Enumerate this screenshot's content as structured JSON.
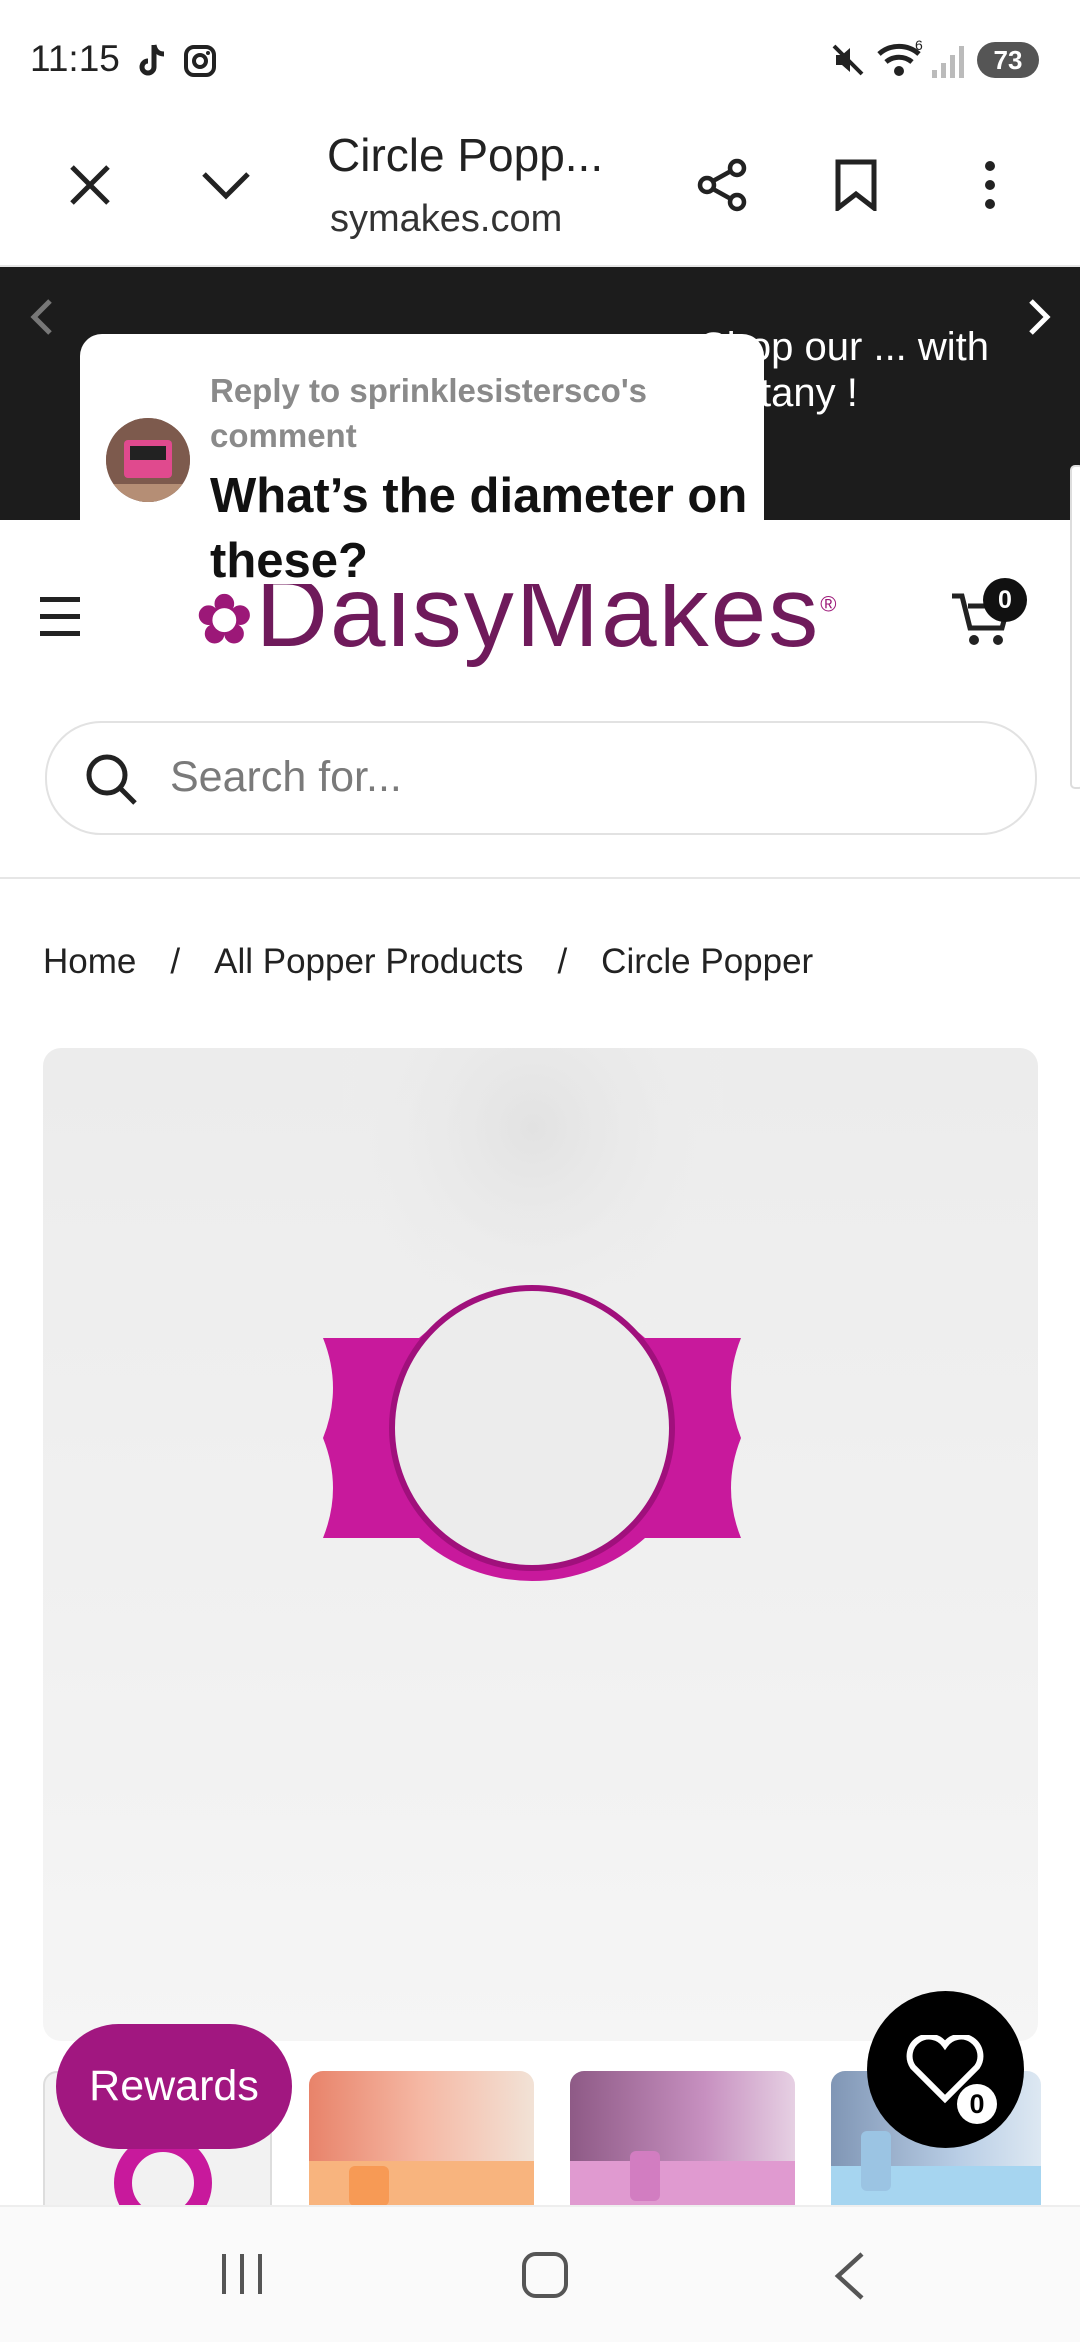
{
  "status_bar": {
    "time": "11:15",
    "battery": "73",
    "signal_label": "6"
  },
  "browser": {
    "title": "Circle Popp...",
    "url": "symakes.com"
  },
  "announcement": {
    "text": "Shop our ... with Brittany !"
  },
  "comment_popup": {
    "reply_label": "Reply to sprinklesistersco's comment",
    "question": "What’s the diameter on these?"
  },
  "site": {
    "logo_text": "DaisyMakes",
    "cart_count": "0"
  },
  "search": {
    "placeholder": "Search for..."
  },
  "breadcrumb": {
    "items": [
      "Home",
      "All Popper Products",
      "Circle Popper"
    ]
  },
  "rewards": {
    "label": "Rewards"
  },
  "wishlist": {
    "count": "0"
  },
  "colors": {
    "brand": "#a11780",
    "logo": "#6f1a5b",
    "announcement_bg": "#1c1c1c",
    "product": "#c8199c"
  }
}
